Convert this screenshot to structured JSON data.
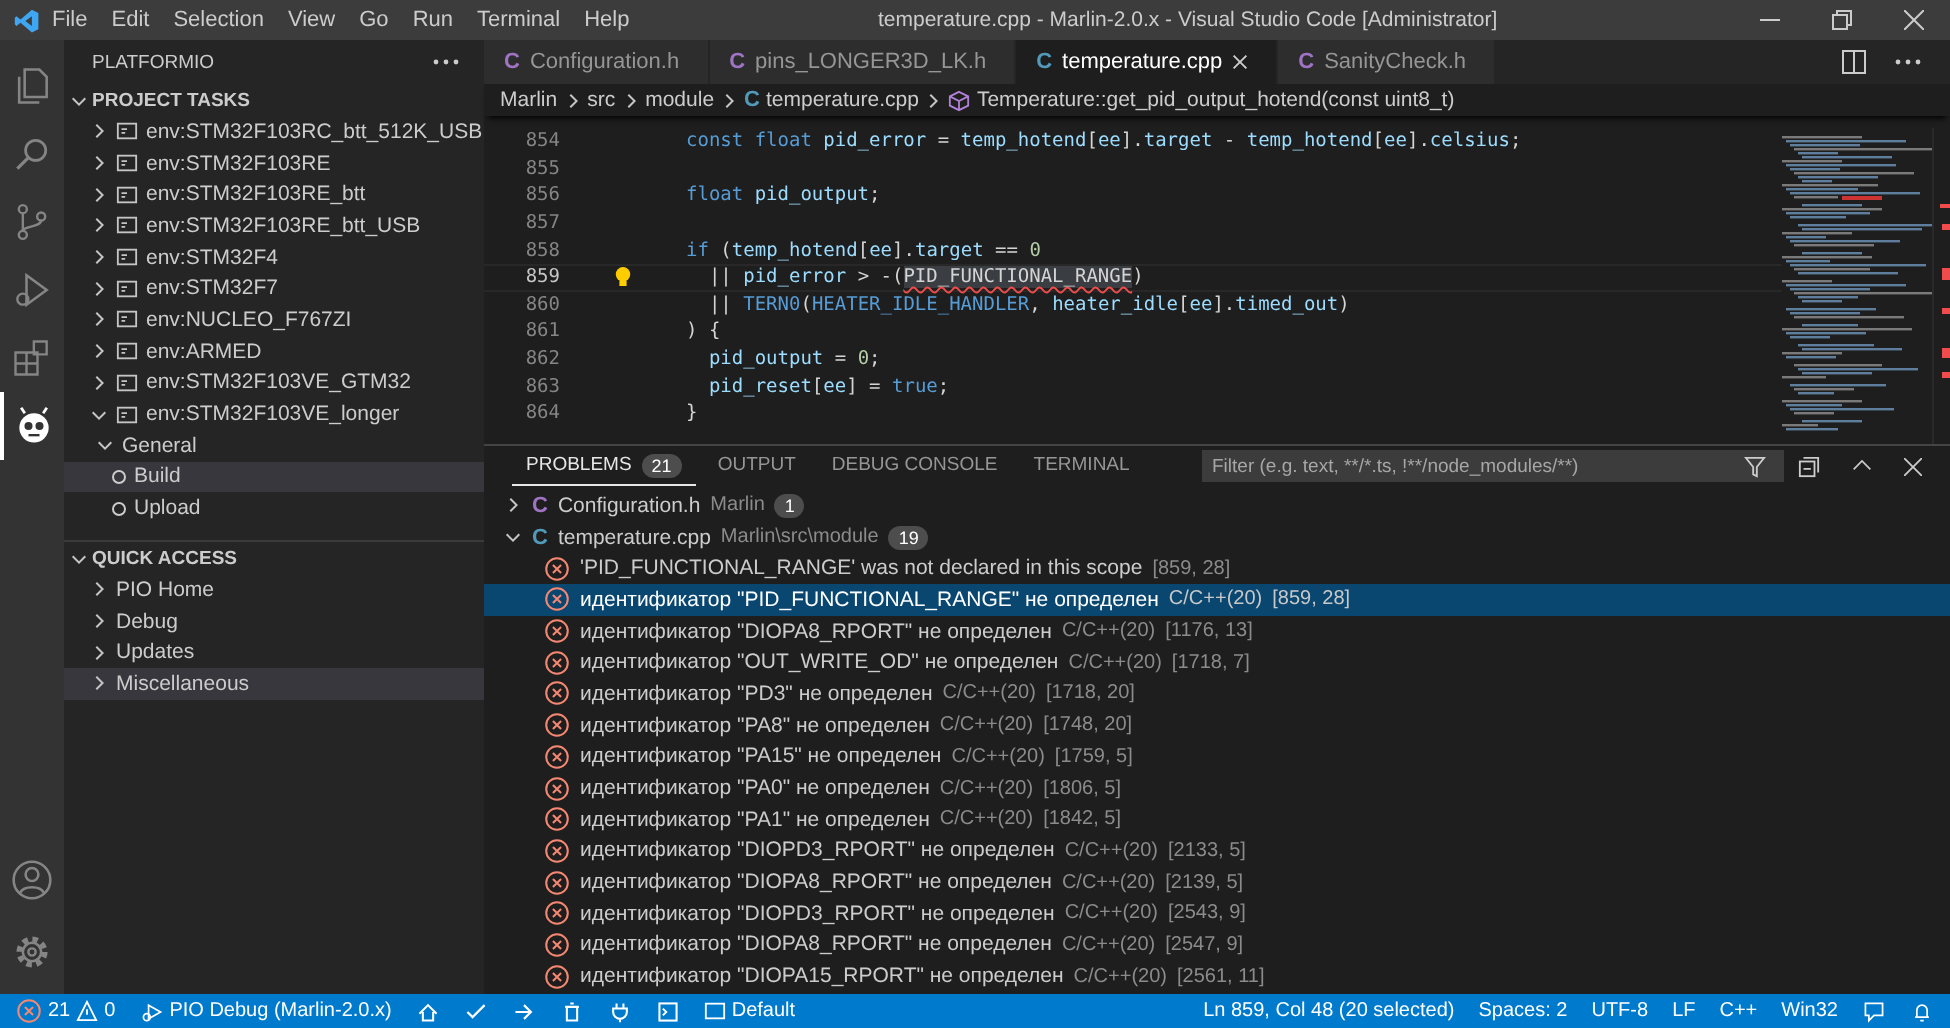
{
  "title_bar": {
    "menus": [
      "File",
      "Edit",
      "Selection",
      "View",
      "Go",
      "Run",
      "Terminal",
      "Help"
    ],
    "title": "temperature.cpp - Marlin-2.0.x - Visual Studio Code [Administrator]"
  },
  "activity_bar": [
    {
      "kind": "files",
      "selected": false
    },
    {
      "kind": "search",
      "selected": false
    },
    {
      "kind": "source-control",
      "selected": false
    },
    {
      "kind": "debug",
      "selected": false
    },
    {
      "kind": "extensions",
      "selected": false
    },
    {
      "kind": "platformio",
      "selected": true
    }
  ],
  "sidebar": {
    "title": "PLATFORMIO",
    "project_tasks": {
      "title": "PROJECT TASKS",
      "items": [
        {
          "label": "env:STM32F103RC_btt_512K_USB",
          "expanded": false
        },
        {
          "label": "env:STM32F103RE",
          "expanded": false
        },
        {
          "label": "env:STM32F103RE_btt",
          "expanded": false
        },
        {
          "label": "env:STM32F103RE_btt_USB",
          "expanded": false
        },
        {
          "label": "env:STM32F4",
          "expanded": false
        },
        {
          "label": "env:STM32F7",
          "expanded": false
        },
        {
          "label": "env:NUCLEO_F767ZI",
          "expanded": false
        },
        {
          "label": "env:ARMED",
          "expanded": false
        },
        {
          "label": "env:STM32F103VE_GTM32",
          "expanded": false
        },
        {
          "label": "env:STM32F103VE_longer",
          "expanded": true,
          "children": [
            {
              "label": "General",
              "expanded": true,
              "children": [
                {
                  "label": "Build",
                  "selected": true
                },
                {
                  "label": "Upload",
                  "selected": false
                }
              ]
            }
          ]
        }
      ]
    },
    "quick_access": {
      "title": "QUICK ACCESS",
      "items": [
        {
          "label": "PIO Home",
          "selected": false
        },
        {
          "label": "Debug",
          "selected": false
        },
        {
          "label": "Updates",
          "selected": false
        },
        {
          "label": "Miscellaneous",
          "selected": true
        }
      ]
    }
  },
  "tabs": [
    {
      "label": "Configuration.h",
      "icon": "C",
      "color": "#a074c4",
      "selected": false
    },
    {
      "label": "pins_LONGER3D_LK.h",
      "icon": "C",
      "color": "#a074c4",
      "selected": false
    },
    {
      "label": "temperature.cpp",
      "icon": "C",
      "color": "#519aba",
      "selected": true
    },
    {
      "label": "SanityCheck.h",
      "icon": "C",
      "color": "#a074c4",
      "selected": false
    }
  ],
  "breadcrumb": [
    {
      "label": "Marlin",
      "kind": "folder"
    },
    {
      "label": "src",
      "kind": "folder"
    },
    {
      "label": "module",
      "kind": "folder"
    },
    {
      "label": "temperature.cpp",
      "kind": "file",
      "icon": "C"
    },
    {
      "label": "Temperature::get_pid_output_hotend(const uint8_t)",
      "kind": "symbol"
    }
  ],
  "code": [
    {
      "number": "854",
      "current": false,
      "tokens": [
        {
          "kind": "kw",
          "text": "const float "
        },
        {
          "kind": "var",
          "text": "pid_error"
        },
        {
          "kind": "op",
          "text": " = "
        },
        {
          "kind": "var",
          "text": "temp_hotend"
        },
        {
          "kind": "op",
          "text": "["
        },
        {
          "kind": "var",
          "text": "ee"
        },
        {
          "kind": "op",
          "text": "]."
        },
        {
          "kind": "var",
          "text": "target"
        },
        {
          "kind": "op",
          "text": " - "
        },
        {
          "kind": "var",
          "text": "temp_hotend"
        },
        {
          "kind": "op",
          "text": "["
        },
        {
          "kind": "var",
          "text": "ee"
        },
        {
          "kind": "op",
          "text": "]."
        },
        {
          "kind": "var",
          "text": "celsius"
        },
        {
          "kind": "op",
          "text": ";"
        }
      ]
    },
    {
      "number": "855",
      "current": false
    },
    {
      "number": "856",
      "current": false,
      "tokens": [
        {
          "kind": "kw",
          "text": "float "
        },
        {
          "kind": "var",
          "text": "pid_output"
        },
        {
          "kind": "op",
          "text": ";"
        }
      ]
    },
    {
      "number": "857",
      "current": false
    },
    {
      "number": "858",
      "current": false,
      "tokens": [
        {
          "kind": "kw",
          "text": "if"
        },
        {
          "kind": "op",
          "text": " ("
        },
        {
          "kind": "var",
          "text": "temp_hotend"
        },
        {
          "kind": "op",
          "text": "["
        },
        {
          "kind": "var",
          "text": "ee"
        },
        {
          "kind": "op",
          "text": "]."
        },
        {
          "kind": "var",
          "text": "target"
        },
        {
          "kind": "op",
          "text": " == "
        },
        {
          "kind": "num",
          "text": "0"
        }
      ]
    },
    {
      "number": "859",
      "current": true,
      "tokens": [
        {
          "kind": "op",
          "text": "  || "
        },
        {
          "kind": "var",
          "text": "pid_error"
        },
        {
          "kind": "op",
          "text": " > -("
        },
        {
          "kind": "err",
          "text": "PID_FUNCTIONAL_RANGE"
        },
        {
          "kind": "op",
          "text": ")"
        }
      ]
    },
    {
      "number": "860",
      "current": false,
      "tokens": [
        {
          "kind": "op",
          "text": "  || "
        },
        {
          "kind": "fn",
          "text": "TERN0"
        },
        {
          "kind": "op",
          "text": "("
        },
        {
          "kind": "fn",
          "text": "HEATER_IDLE_HANDLER"
        },
        {
          "kind": "op",
          "text": ", "
        },
        {
          "kind": "var",
          "text": "heater_idle"
        },
        {
          "kind": "op",
          "text": "["
        },
        {
          "kind": "var",
          "text": "ee"
        },
        {
          "kind": "op",
          "text": "]."
        },
        {
          "kind": "var",
          "text": "timed_out"
        },
        {
          "kind": "op",
          "text": ")"
        }
      ]
    },
    {
      "number": "861",
      "current": false,
      "tokens": [
        {
          "kind": "op",
          "text": ") {"
        }
      ]
    },
    {
      "number": "862",
      "current": false,
      "tokens": [
        {
          "kind": "var",
          "text": "  pid_output"
        },
        {
          "kind": "op",
          "text": " = "
        },
        {
          "kind": "num",
          "text": "0"
        },
        {
          "kind": "op",
          "text": ";"
        }
      ]
    },
    {
      "number": "863",
      "current": false,
      "tokens": [
        {
          "kind": "var",
          "text": "  pid_reset"
        },
        {
          "kind": "op",
          "text": "["
        },
        {
          "kind": "var",
          "text": "ee"
        },
        {
          "kind": "op",
          "text": "] = "
        },
        {
          "kind": "kw",
          "text": "true"
        },
        {
          "kind": "op",
          "text": ";"
        }
      ]
    },
    {
      "number": "864",
      "current": false,
      "tokens": [
        {
          "kind": "op",
          "text": "}"
        }
      ]
    }
  ],
  "panel": {
    "tabs": [
      {
        "label": "PROBLEMS",
        "badge": "21",
        "selected": true
      },
      {
        "label": "OUTPUT",
        "selected": false
      },
      {
        "label": "DEBUG CONSOLE",
        "selected": false
      },
      {
        "label": "TERMINAL",
        "selected": false
      }
    ],
    "filter": {
      "placeholder": "Filter (e.g. text, **/*.ts, !**/node_modules/**)"
    },
    "groups": [
      {
        "file": "Configuration.h",
        "color": "#a074c4",
        "icon": "C",
        "path": "Marlin",
        "count": "1",
        "expanded": false
      },
      {
        "file": "temperature.cpp",
        "color": "#519aba",
        "icon": "C",
        "path": "Marlin\\src\\module",
        "count": "19",
        "expanded": true,
        "problems": [
          {
            "message": "'PID_FUNCTIONAL_RANGE' was not declared in this scope",
            "position": "[859, 28]",
            "selected": false
          },
          {
            "message": "идентификатор \"PID_FUNCTIONAL_RANGE\" не определен",
            "source": "C/C++(20)",
            "position": "[859, 28]",
            "selected": true
          },
          {
            "message": "идентификатор \"DIOPA8_RPORT\" не определен",
            "source": "C/C++(20)",
            "position": "[1176, 13]",
            "selected": false
          },
          {
            "message": "идентификатор \"OUT_WRITE_OD\" не определен",
            "source": "C/C++(20)",
            "position": "[1718, 7]",
            "selected": false
          },
          {
            "message": "идентификатор \"PD3\" не определен",
            "source": "C/C++(20)",
            "position": "[1718, 20]",
            "selected": false
          },
          {
            "message": "идентификатор \"PA8\" не определен",
            "source": "C/C++(20)",
            "position": "[1748, 20]",
            "selected": false
          },
          {
            "message": "идентификатор \"PA15\" не определен",
            "source": "C/C++(20)",
            "position": "[1759, 5]",
            "selected": false
          },
          {
            "message": "идентификатор \"PA0\" не определен",
            "source": "C/C++(20)",
            "position": "[1806, 5]",
            "selected": false
          },
          {
            "message": "идентификатор \"PA1\" не определен",
            "source": "C/C++(20)",
            "position": "[1842, 5]",
            "selected": false
          },
          {
            "message": "идентификатор \"DIOPD3_RPORT\" не определен",
            "source": "C/C++(20)",
            "position": "[2133, 5]",
            "selected": false
          },
          {
            "message": "идентификатор \"DIOPA8_RPORT\" не определен",
            "source": "C/C++(20)",
            "position": "[2139, 5]",
            "selected": false
          },
          {
            "message": "идентификатор \"DIOPD3_RPORT\" не определен",
            "source": "C/C++(20)",
            "position": "[2543, 9]",
            "selected": false
          },
          {
            "message": "идентификатор \"DIOPA8_RPORT\" не определен",
            "source": "C/C++(20)",
            "position": "[2547, 9]",
            "selected": false
          },
          {
            "message": "идентификатор \"DIOPA15_RPORT\" не определен",
            "source": "C/C++(20)",
            "position": "[2561, 11]",
            "selected": false
          }
        ]
      }
    ]
  },
  "status_bar": {
    "errors": "21",
    "warnings": "0",
    "debug": "PIO Debug (Marlin-2.0.x)",
    "tools": [
      {
        "kind": "home"
      },
      {
        "kind": "check"
      },
      {
        "kind": "arrow"
      },
      {
        "kind": "trash"
      },
      {
        "kind": "plug"
      },
      {
        "kind": "terminal"
      }
    ],
    "environment": "Default",
    "right": [
      "Ln 859, Col 48 (20 selected)",
      "Spaces: 2",
      "UTF-8",
      "LF",
      "C++",
      "Win32"
    ]
  }
}
